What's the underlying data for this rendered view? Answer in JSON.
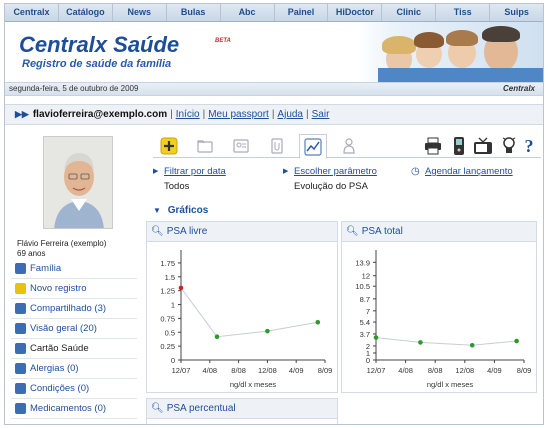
{
  "topnav": [
    "Centralx",
    "Catálogo",
    "News",
    "Bulas",
    "Abc",
    "Painel",
    "HiDoctor",
    "Clinic",
    "Tiss",
    "Suips"
  ],
  "header": {
    "brand": "Centralx Saúde",
    "beta": "BETA",
    "tagline": "Registro de saúde da família",
    "date": "segunda-feira, 5 de outubro de 2009",
    "brand_small": "Centralx"
  },
  "userbar": {
    "email": "flavioferreira@exemplo.com",
    "links": [
      "Início",
      "Meu passport",
      "Ajuda",
      "Sair"
    ]
  },
  "profile": {
    "name": "Flávio Ferreira (exemplo)",
    "age": "69 anos"
  },
  "menu": [
    {
      "label": "Família",
      "icon": "family-icon",
      "color": "#3a6db5"
    },
    {
      "label": "Novo registro",
      "icon": "add-icon",
      "color": "#e8c20c"
    },
    {
      "label": "Compartilhado (3)",
      "icon": "share-icon",
      "color": "#3a6db5"
    },
    {
      "label": "Visão geral (20)",
      "icon": "overview-icon",
      "color": "#3a6db5"
    },
    {
      "label": "Cartão Saúde",
      "icon": "health-card-icon",
      "color": "#3a6db5",
      "static": true
    },
    {
      "label": "Alergias (0)",
      "icon": "allergy-icon",
      "color": "#3a6db5"
    },
    {
      "label": "Condições (0)",
      "icon": "conditions-icon",
      "color": "#3a6db5"
    },
    {
      "label": "Medicamentos (0)",
      "icon": "medication-icon",
      "color": "#3a6db5"
    }
  ],
  "filters": {
    "filter_link": "Filtrar por data",
    "filter_value": "Todos",
    "param_link": "Escolher parâmetro",
    "param_value": "Evolução do PSA",
    "schedule_link": "Agendar lançamento"
  },
  "section_title": "Gráficos",
  "chart_data": [
    {
      "type": "line",
      "title": "PSA livre",
      "xlabel": "ng/dl x meses",
      "x_ticks": [
        "12/07",
        "4/08",
        "8/08",
        "12/08",
        "4/09",
        "8/09"
      ],
      "y_ticks": [
        "0",
        "0.25",
        "0.5",
        "0.75",
        "1",
        "1.25",
        "1.5",
        "1.75"
      ],
      "ylim": [
        0,
        1.875
      ],
      "x": [
        "12/07",
        "5/08",
        "12/08",
        "7/09"
      ],
      "values": [
        1.3,
        0.42,
        0.52,
        0.68
      ],
      "highlight_first_color": "#cc2222",
      "point_color": "#2a9a2a"
    },
    {
      "type": "line",
      "title": "PSA total",
      "xlabel": "ng/dl x meses",
      "x_ticks": [
        "12/07",
        "4/08",
        "8/08",
        "12/08",
        "4/09",
        "8/09"
      ],
      "y_ticks": [
        "0",
        "1",
        "2",
        "3.7",
        "5.4",
        "7",
        "8.7",
        "10.5",
        "12",
        "13.9"
      ],
      "ylim": [
        0,
        14.8
      ],
      "x": [
        "12/07",
        "6/08",
        "1/09",
        "7/09"
      ],
      "values": [
        3.2,
        2.5,
        2.1,
        2.7
      ],
      "point_color": "#2a9a2a"
    },
    {
      "type": "line",
      "title": "PSA percentual"
    }
  ]
}
